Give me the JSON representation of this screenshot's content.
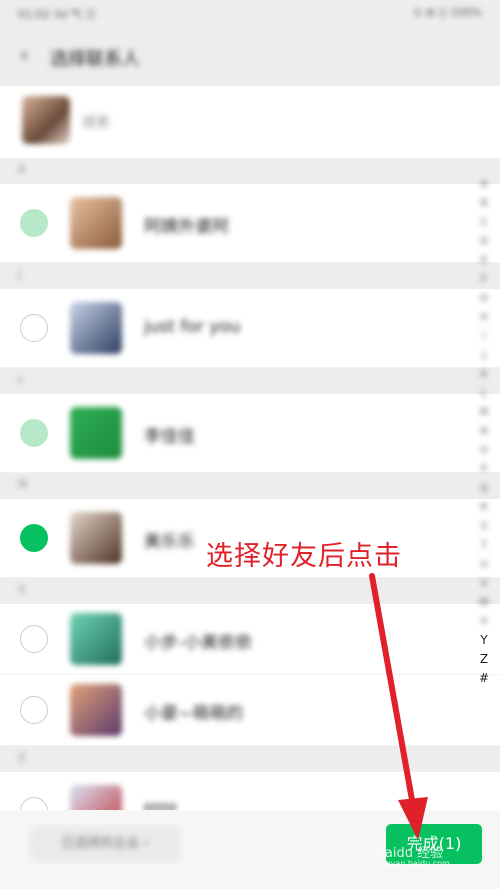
{
  "statusbar": {
    "left": "01:02 3d 气 Ⓢ",
    "right": "⊙ ⊕ ⟨⟩ 100%"
  },
  "header": {
    "title": "选择联系人"
  },
  "search": {
    "hint": "搜索"
  },
  "sections": [
    {
      "letter": "A",
      "contacts": [
        {
          "name": "阿姨外婆阿",
          "state": "locked",
          "avatar_colors": [
            "#e8c2a0",
            "#8a5a3c"
          ]
        }
      ]
    },
    {
      "letter": "J",
      "contacts": [
        {
          "name": "just for you",
          "state": "unchecked",
          "avatar_colors": [
            "#c7d3e6",
            "#2d3e63"
          ]
        }
      ]
    },
    {
      "letter": "L",
      "contacts": [
        {
          "name": "李佳佳",
          "state": "locked",
          "avatar_colors": [
            "#2fae55",
            "#1c8c3d"
          ]
        }
      ]
    },
    {
      "letter": "M",
      "contacts": [
        {
          "name": "美乐乐",
          "state": "checked",
          "avatar_colors": [
            "#e6d6c8",
            "#4d3325"
          ]
        }
      ]
    },
    {
      "letter": "X",
      "contacts": [
        {
          "name": "小步-小美依依",
          "state": "unchecked",
          "avatar_colors": [
            "#6fd3b5",
            "#1f6d5a"
          ]
        },
        {
          "name": "小豪~萌萌的",
          "state": "unchecked",
          "avatar_colors": [
            "#e3a27a",
            "#5a3a6a"
          ]
        }
      ]
    },
    {
      "letter": "Z",
      "contacts": [
        {
          "name": "ttttt",
          "state": "unchecked",
          "avatar_colors": [
            "#d8e2f5",
            "#c0353b"
          ]
        }
      ]
    }
  ],
  "index_letters": [
    "A",
    "B",
    "C",
    "D",
    "E",
    "F",
    "G",
    "H",
    "I",
    "J",
    "K",
    "L",
    "M",
    "N",
    "O",
    "P",
    "Q",
    "R",
    "S",
    "T",
    "U",
    "V",
    "W",
    "X",
    "Y",
    "Z",
    "#"
  ],
  "bottombar": {
    "selected_label": "已选择的企业 ›",
    "done_label": "完成(1)"
  },
  "annotation": {
    "text": "选择好友后点击",
    "color": "#e0212a"
  },
  "watermark": {
    "text": "Baidu 经验",
    "sub": "jingyan.baidu.com"
  },
  "colors": {
    "accent": "#07c160",
    "background": "#ededed"
  }
}
